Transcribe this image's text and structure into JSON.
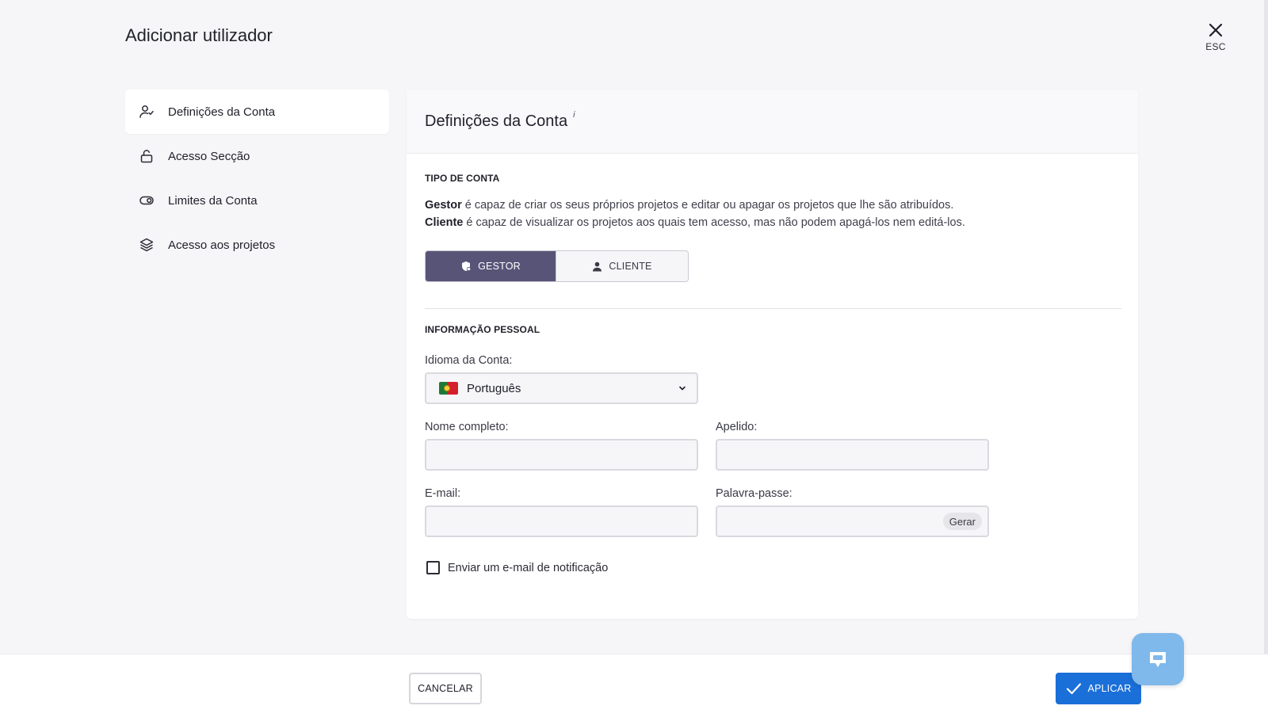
{
  "header": {
    "title": "Adicionar utilizador",
    "close_hint": "ESC"
  },
  "sidebar": {
    "items": [
      {
        "label": "Definições da Conta",
        "icon": "user-check-icon",
        "active": true
      },
      {
        "label": "Acesso Secção",
        "icon": "lock-open-icon",
        "active": false
      },
      {
        "label": "Limites da Conta",
        "icon": "toggle-icon",
        "active": false
      },
      {
        "label": "Acesso aos projetos",
        "icon": "layers-icon",
        "active": false
      }
    ]
  },
  "card": {
    "title": "Definições da Conta",
    "info_marker": "i",
    "account_type": {
      "section_label": "TIPO DE CONTA",
      "line1_bold": "Gestor",
      "line1_rest": " é capaz de criar os seus próprios projetos e editar ou apagar os projetos que lhe são atribuídos.",
      "line2_bold": "Cliente",
      "line2_rest": " é capaz de visualizar os projetos aos quais tem acesso, mas não podem apagá-los nem editá-los.",
      "options": [
        {
          "label": "GESTOR",
          "icon": "shield-user-icon",
          "selected": true
        },
        {
          "label": "CLIENTE",
          "icon": "person-icon",
          "selected": false
        }
      ]
    },
    "personal": {
      "section_label": "INFORMAÇÃO PESSOAL",
      "language_label": "Idioma da Conta:",
      "language_value": "Português",
      "language_flag": "portugal-flag-icon",
      "full_name_label": "Nome completo:",
      "full_name_value": "",
      "surname_label": "Apelido:",
      "surname_value": "",
      "email_label": "E-mail:",
      "email_value": "",
      "password_label": "Palavra-passe:",
      "password_value": "",
      "generate_label": "Gerar",
      "notify_label": "Enviar um e-mail de notificação",
      "notify_checked": false
    }
  },
  "footer": {
    "cancel_label": "CANCELAR",
    "apply_label": "APLICAR"
  },
  "colors": {
    "selected_segment": "#585478",
    "apply_button": "#1b6fd8",
    "chat_button": "#7fb8ea"
  }
}
